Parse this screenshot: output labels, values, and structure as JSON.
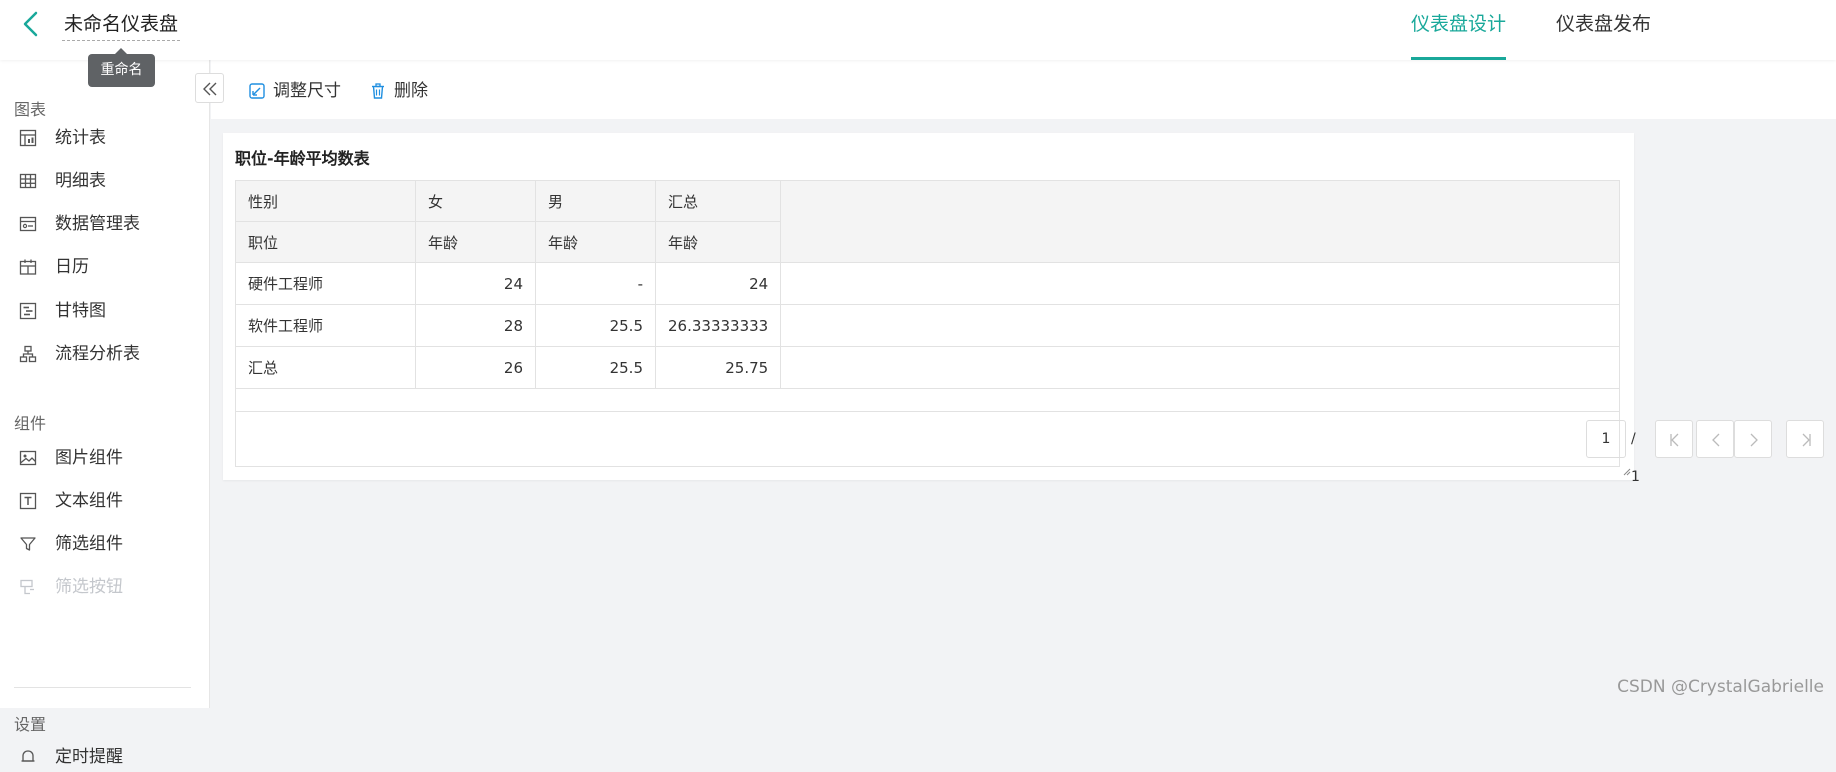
{
  "header": {
    "title": "未命名仪表盘",
    "tooltip": "重命名",
    "tabs": [
      {
        "label": "仪表盘设计",
        "active": true
      },
      {
        "label": "仪表盘发布",
        "active": false
      }
    ],
    "accent_color": "#19a89a"
  },
  "sidebar": {
    "sections": [
      {
        "title": "图表",
        "items": [
          {
            "label": "统计表",
            "icon": "stat-table-icon"
          },
          {
            "label": "明细表",
            "icon": "grid-table-icon"
          },
          {
            "label": "数据管理表",
            "icon": "data-manage-icon"
          },
          {
            "label": "日历",
            "icon": "calendar-icon"
          },
          {
            "label": "甘特图",
            "icon": "gantt-icon"
          },
          {
            "label": "流程分析表",
            "icon": "flow-icon"
          }
        ]
      },
      {
        "title": "组件",
        "items": [
          {
            "label": "图片组件",
            "icon": "image-icon"
          },
          {
            "label": "文本组件",
            "icon": "text-icon"
          },
          {
            "label": "筛选组件",
            "icon": "filter-icon"
          },
          {
            "label": "筛选按钮",
            "icon": "filter-button-icon",
            "disabled": true
          }
        ]
      },
      {
        "title": "设置",
        "items": [
          {
            "label": "定时提醒",
            "icon": "bell-icon"
          }
        ]
      }
    ]
  },
  "toolbar": {
    "resize_label": "调整尺寸",
    "delete_label": "删除"
  },
  "widget": {
    "title": "职位-年龄平均数表",
    "header_row1": [
      "性别",
      "女",
      "男",
      "汇总"
    ],
    "header_row2": [
      "职位",
      "年龄",
      "年龄",
      "年龄"
    ],
    "rows": [
      [
        "硬件工程师",
        "24",
        "-",
        "24"
      ],
      [
        "软件工程师",
        "28",
        "25.5",
        "26.33333333"
      ],
      [
        "汇总",
        "26",
        "25.5",
        "25.75"
      ]
    ],
    "pagination": {
      "current": "1",
      "total": "/ 1"
    }
  },
  "watermark": "CSDN @CrystalGabrielle"
}
